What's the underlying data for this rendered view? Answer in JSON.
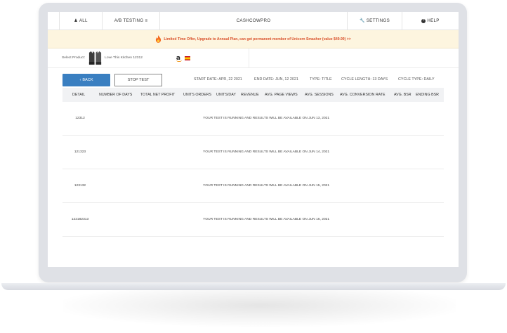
{
  "nav": {
    "all_label": "ALL",
    "ab_label": "A/B TESTING",
    "brand": "CASHCOWPRO",
    "settings_label": "SETTINGS",
    "help_label": "HELP"
  },
  "banner": {
    "text": "Limited Time Offer, Upgrade to Annual Plan, can get permanent member of Unicorn Smasher (value $49.99) >>",
    "color": "#d9502a"
  },
  "product": {
    "select_label": "Select Product:",
    "name": "Love This Kitchen 12312",
    "marketplace_icon": "amazon-icon",
    "country_icon": "spain-flag-icon"
  },
  "controls": {
    "back_label": "BACK",
    "stop_label": "STOP TEST",
    "start_date": "START DATE: APR, 22 2021",
    "end_date": "END DATE: JUN, 12 2021",
    "type": "TYPE: TITLE",
    "cycle_length": "CYCLE LENGTH: 13 DAYS",
    "cycle_type": "CYCLE TYPE: DAILY",
    "accent": "#3a7fc1"
  },
  "table": {
    "headers": [
      "DETAIL",
      "NUMBER OF DAYS",
      "TOTAL NET PROFIT",
      "UNITS ORDERS",
      "UNITS/DAY",
      "REVENUE",
      "AVG. PAGE VIEWS",
      "AVG. SESSIONS",
      "AVG. CONVERSION RATE",
      "AVG. BSR",
      "ENDING BSR"
    ],
    "rows": [
      {
        "detail": "12312",
        "message": "YOUR TEST IS RUNNING AND RESULTS WILL BE AVAILABLE ON JUN 13, 2021"
      },
      {
        "detail": "121323",
        "message": "YOUR TEST IS RUNNING AND RESULTS WILL BE AVAILABLE ON JUN 14, 2021"
      },
      {
        "detail": "123132",
        "message": "YOUR TEST IS RUNNING AND RESULTS WILL BE AVAILABLE ON JUN 15, 2021"
      },
      {
        "detail": "122182313",
        "message": "YOUR TEST IS RUNNING AND RESULTS WILL BE AVAILABLE ON JUN 16, 2021"
      }
    ]
  }
}
